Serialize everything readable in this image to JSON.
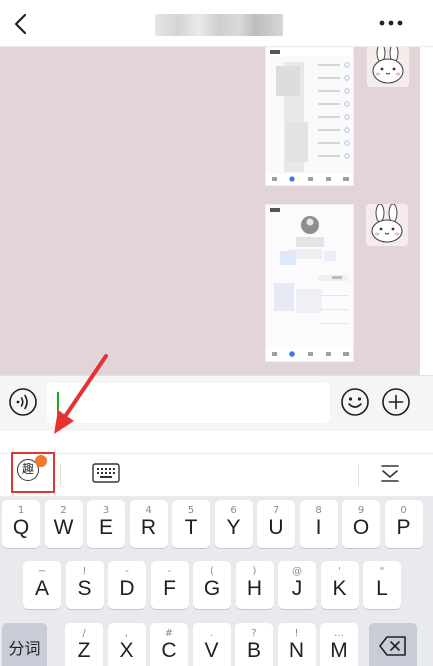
{
  "header": {
    "back_icon": "chevron-left-icon",
    "title": "",
    "more_icon": "more-horizontal-icon"
  },
  "chat": {
    "background": "#e3d4da",
    "messages": [
      {
        "type": "image",
        "content": "screenshot",
        "sender_avatar": "bunny-sticker-avatar"
      },
      {
        "type": "image",
        "content": "screenshot",
        "sender_avatar": "bunny-sticker-avatar"
      }
    ]
  },
  "input_bar": {
    "voice_icon": "voice-icon",
    "message_value": "",
    "emoji_icon": "emoji-icon",
    "plus_icon": "plus-circle-icon",
    "caret_color": "#1aad19"
  },
  "ime_toolbar": {
    "qu_label": "趣",
    "qu_badge_color": "#f07a2c",
    "highlight_color": "#e53333",
    "keyboard_icon": "keyboard-icon",
    "collapse_icon": "collapse-keyboard-icon"
  },
  "keyboard": {
    "row1": [
      {
        "label": "Q",
        "sub": "1"
      },
      {
        "label": "W",
        "sub": "2"
      },
      {
        "label": "E",
        "sub": "3"
      },
      {
        "label": "R",
        "sub": "4"
      },
      {
        "label": "T",
        "sub": "5"
      },
      {
        "label": "Y",
        "sub": "6"
      },
      {
        "label": "U",
        "sub": "7"
      },
      {
        "label": "I",
        "sub": "8"
      },
      {
        "label": "O",
        "sub": "9"
      },
      {
        "label": "P",
        "sub": "0"
      }
    ],
    "row2": [
      {
        "label": "A",
        "sub": "~"
      },
      {
        "label": "S",
        "sub": "!"
      },
      {
        "label": "D",
        "sub": "-"
      },
      {
        "label": "F",
        "sub": "-"
      },
      {
        "label": "G",
        "sub": "("
      },
      {
        "label": "H",
        "sub": ")"
      },
      {
        "label": "J",
        "sub": "@"
      },
      {
        "label": "K",
        "sub": "'"
      },
      {
        "label": "L",
        "sub": "\""
      }
    ],
    "row3": [
      {
        "label": "Z",
        "sub": "/"
      },
      {
        "label": "X",
        "sub": ","
      },
      {
        "label": "C",
        "sub": "#"
      },
      {
        "label": "V",
        "sub": "."
      },
      {
        "label": "B",
        "sub": "?"
      },
      {
        "label": "N",
        "sub": "!"
      },
      {
        "label": "M",
        "sub": "…"
      }
    ],
    "fenci_label": "分词",
    "backspace_icon": "backspace-icon"
  },
  "annotation": {
    "arrow_color": "#e53333"
  }
}
